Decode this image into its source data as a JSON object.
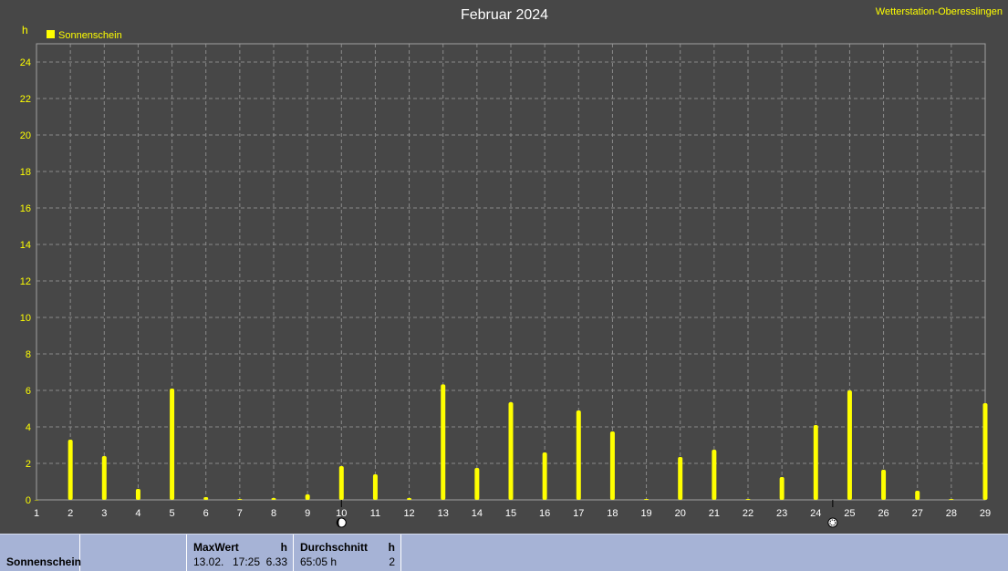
{
  "chart_data": {
    "type": "bar",
    "title": "Februar 2024",
    "station": "Wetterstation-Oberesslingen",
    "ylabel": "h",
    "ylim": [
      0,
      25
    ],
    "yticks": [
      0,
      2,
      4,
      6,
      8,
      10,
      12,
      14,
      16,
      18,
      20,
      22,
      24
    ],
    "grid": true,
    "legend_position": "top-left",
    "categories": [
      "1",
      "2",
      "3",
      "4",
      "5",
      "6",
      "7",
      "8",
      "9",
      "10",
      "11",
      "12",
      "13",
      "14",
      "15",
      "16",
      "17",
      "18",
      "19",
      "20",
      "21",
      "22",
      "23",
      "24",
      "25",
      "26",
      "27",
      "28",
      "29"
    ],
    "series": [
      {
        "name": "Sonnenschein",
        "color": "#ffff00",
        "values": [
          0,
          3.3,
          2.4,
          0.6,
          6.1,
          0.15,
          0.05,
          0.1,
          0.3,
          1.85,
          1.4,
          0.1,
          6.33,
          1.75,
          5.35,
          2.6,
          4.9,
          3.75,
          0.05,
          2.35,
          2.75,
          0.05,
          1.25,
          4.1,
          6.0,
          1.65,
          0.5,
          0.05,
          5.3
        ]
      }
    ],
    "moon_markers": [
      {
        "day": 10,
        "icon": "new-moon-icon"
      },
      {
        "day": 24.5,
        "icon": "full-moon-icon"
      }
    ]
  },
  "footer": {
    "row_label": "Sonnenschein",
    "max": {
      "header": "MaxWert",
      "unit": "h",
      "date": "13.02.",
      "time": "17:25",
      "value": "6.33"
    },
    "avg": {
      "header": "Durchschnitt",
      "unit": "h",
      "total": "65:05 h",
      "value": "2"
    }
  },
  "colors": {
    "background": "#474747",
    "plot_border": "#9a9a9a",
    "grid": "#8a8a8a",
    "bar": "#ffff00",
    "axis_text_y": "#ffff00",
    "axis_text_x": "#ffffff",
    "footer_bg": "#a6b3d6"
  }
}
